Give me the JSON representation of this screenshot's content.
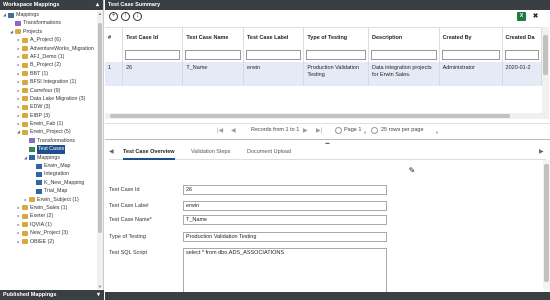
{
  "left_panel": {
    "title": "Workspace Mappings",
    "bottom_title": "Published Mappings",
    "tree": [
      {
        "label": "Mappings",
        "icon": "root",
        "tog": "◢",
        "indent": 0
      },
      {
        "label": "Transformations",
        "icon": "trans",
        "tog": "",
        "indent": 1
      },
      {
        "label": "Projects",
        "icon": "folder",
        "tog": "◢",
        "indent": 1
      },
      {
        "label": "A_Project (6)",
        "icon": "folder",
        "tog": "▸",
        "indent": 2
      },
      {
        "label": "AdventureWorks_Migration",
        "icon": "folder",
        "tog": "▸",
        "indent": 2
      },
      {
        "label": "AFJ_Demo (1)",
        "icon": "folder",
        "tog": "▸",
        "indent": 2
      },
      {
        "label": "B_Project (2)",
        "icon": "folder",
        "tog": "▸",
        "indent": 2
      },
      {
        "label": "BBT (1)",
        "icon": "folder",
        "tog": "▸",
        "indent": 2
      },
      {
        "label": "BFSI Integration (1)",
        "icon": "folder",
        "tog": "▸",
        "indent": 2
      },
      {
        "label": "Carrefour (9)",
        "icon": "folder",
        "tog": "▸",
        "indent": 2
      },
      {
        "label": "Data Lake Migration (3)",
        "icon": "folder",
        "tog": "▸",
        "indent": 2
      },
      {
        "label": "EDW (3)",
        "icon": "folder",
        "tog": "▸",
        "indent": 2
      },
      {
        "label": "EIBP (3)",
        "icon": "folder",
        "tog": "▸",
        "indent": 2
      },
      {
        "label": "Erwin_Fab (1)",
        "icon": "folder",
        "tog": "▸",
        "indent": 2
      },
      {
        "label": "Erwin_Project (5)",
        "icon": "folder",
        "tog": "◢",
        "indent": 2
      },
      {
        "label": "Transformations",
        "icon": "trans",
        "tog": "",
        "indent": 3
      },
      {
        "label": "Test Cases",
        "icon": "tc",
        "tog": "",
        "indent": 3,
        "selected": true
      },
      {
        "label": "Mappings",
        "icon": "map",
        "tog": "◢",
        "indent": 3
      },
      {
        "label": "Erwin_Map",
        "icon": "map",
        "tog": "",
        "indent": 4
      },
      {
        "label": "Integration",
        "icon": "map",
        "tog": "",
        "indent": 4
      },
      {
        "label": "K_New_Mapping",
        "icon": "map",
        "tog": "",
        "indent": 4
      },
      {
        "label": "Trial_Map",
        "icon": "map",
        "tog": "",
        "indent": 4
      },
      {
        "label": "Erwin_Subject (1)",
        "icon": "folder",
        "tog": "▸",
        "indent": 3
      },
      {
        "label": "Erwin_Sales (1)",
        "icon": "folder",
        "tog": "▸",
        "indent": 2
      },
      {
        "label": "Exeter (2)",
        "icon": "folder",
        "tog": "▸",
        "indent": 2
      },
      {
        "label": "IQVIA (1)",
        "icon": "folder",
        "tog": "▸",
        "indent": 2
      },
      {
        "label": "New_Project (3)",
        "icon": "folder",
        "tog": "▸",
        "indent": 2
      },
      {
        "label": "OBIEE (2)",
        "icon": "folder",
        "tog": "▸",
        "indent": 2
      }
    ]
  },
  "right_panel": {
    "title": "Test Case Summary",
    "toolbar": {
      "add": "+",
      "up": "↑",
      "down": "↓",
      "excel": "X",
      "close": "✖"
    },
    "columns": [
      "#",
      "Test Case Id",
      "Test Case Name",
      "Test Case Label",
      "Type of Testing",
      "Description",
      "Created By",
      "Created Da"
    ],
    "rows": [
      [
        "1",
        "26",
        "T_Name",
        "erwin",
        "Production Validation Testing",
        "Data integration projects for Erwin Sales.",
        "Administrator",
        "2020-01-2"
      ]
    ],
    "pager": {
      "records": "Records from 1 to 1",
      "page": "Page 1",
      "per_page": "25 rows per page"
    },
    "tabs": [
      "Test Case Overview",
      "Validation Steps",
      "Document Upload"
    ],
    "form": [
      {
        "label": "Test Case Id",
        "value": "26",
        "required": false
      },
      {
        "label": "Test Case Label",
        "value": "erwin",
        "required": false
      },
      {
        "label": "Test Case Name",
        "value": "T_Name",
        "required": true
      },
      {
        "label": "Type of Testing",
        "value": "Production Validation Testing",
        "required": false
      },
      {
        "label": "Test SQL Script",
        "value": "select * from dbo.ADS_ASSOCIATIONS",
        "required": false
      }
    ]
  }
}
